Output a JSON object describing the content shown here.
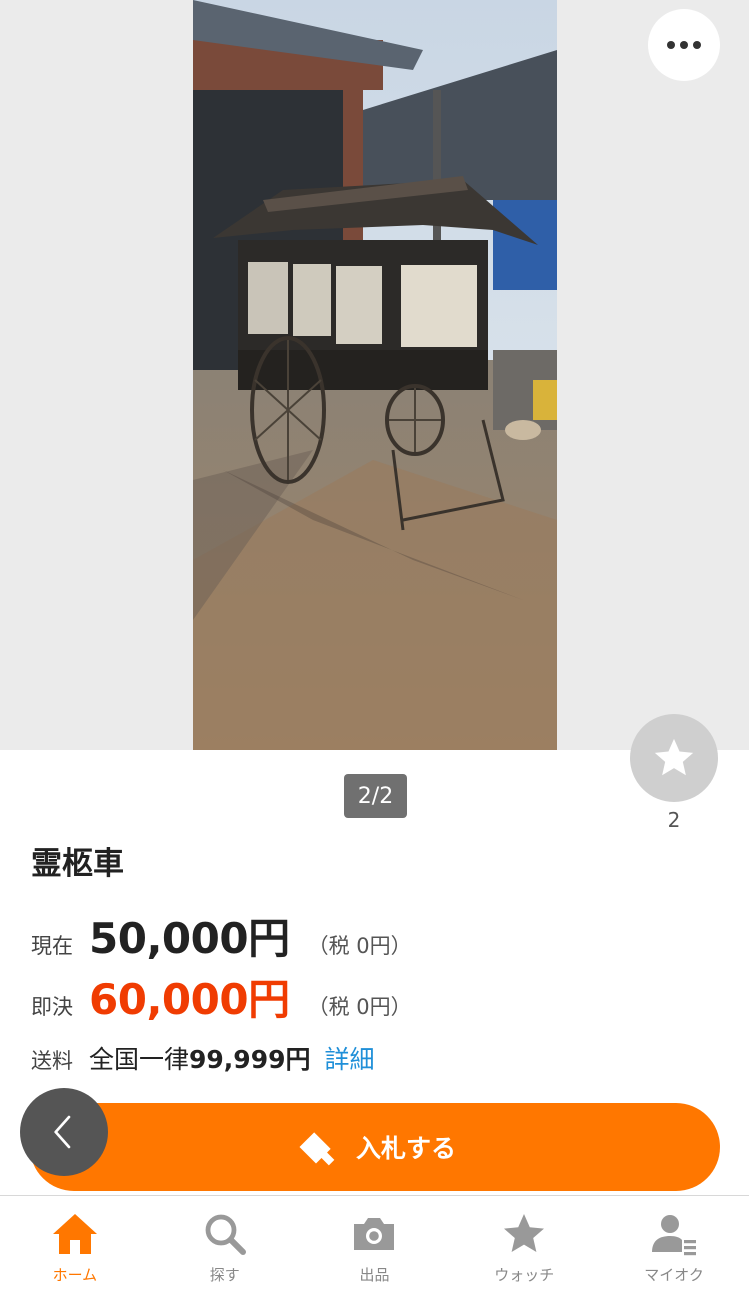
{
  "listing": {
    "pager": "2/2",
    "title": "霊柩車",
    "watch_count": "2"
  },
  "price": {
    "current_label": "現在",
    "current_value": "50,000円",
    "current_tax": "（税 0円）",
    "buynow_label": "即決",
    "buynow_value": "60,000円",
    "buynow_tax": "（税 0円）"
  },
  "shipping": {
    "label": "送料",
    "prefix": "全国一律",
    "amount": "99,999円",
    "detail_link": "詳細"
  },
  "actions": {
    "bid_label": "入札する"
  },
  "tabs": [
    {
      "label": "ホーム",
      "icon": "home-icon",
      "active": true
    },
    {
      "label": "探す",
      "icon": "search-icon",
      "active": false
    },
    {
      "label": "出品",
      "icon": "camera-icon",
      "active": false
    },
    {
      "label": "ウォッチ",
      "icon": "star-icon",
      "active": false
    },
    {
      "label": "マイオク",
      "icon": "user-icon",
      "active": false
    }
  ],
  "colors": {
    "accent": "#ff7700",
    "buynow_price": "#f03c02",
    "link": "#1f8fd8"
  }
}
